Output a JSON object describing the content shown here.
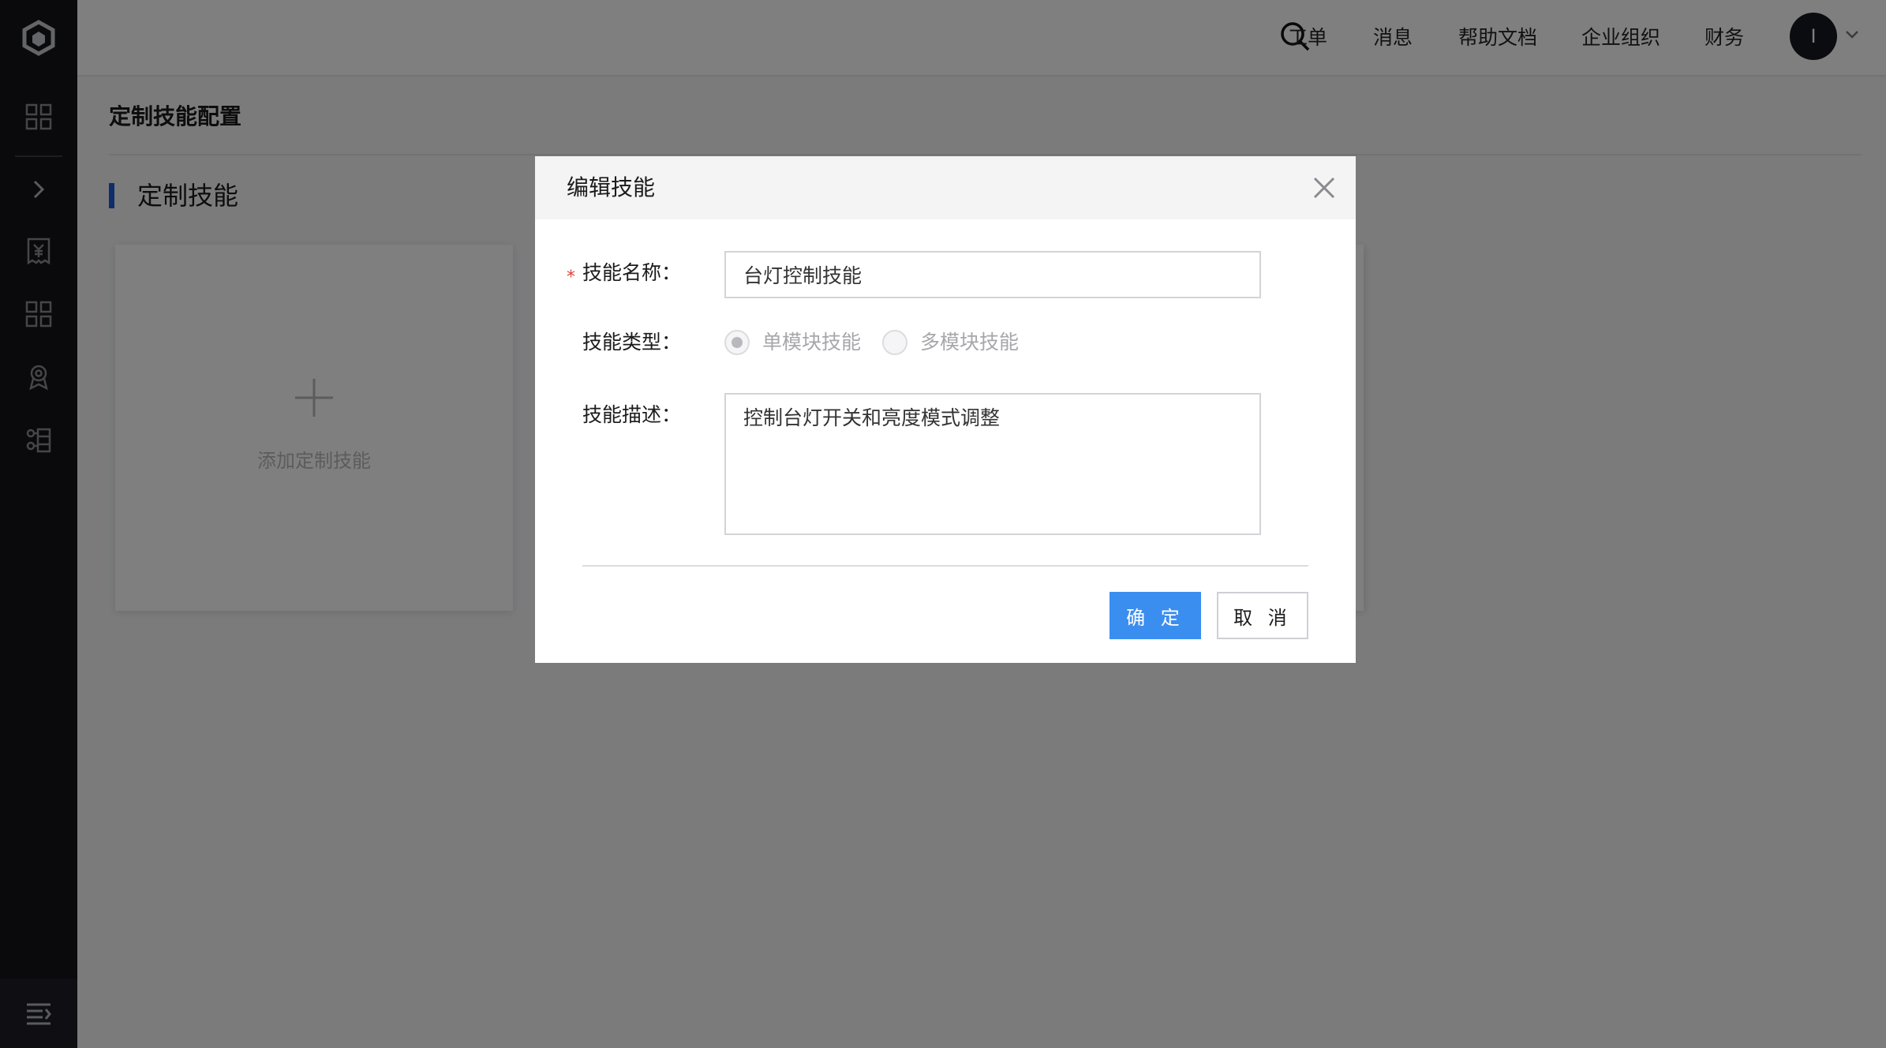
{
  "colors": {
    "sidebar_bg": "#14151b",
    "accent": "#1f5bd7",
    "primary_button": "#3a8ef0",
    "required": "#e0423d"
  },
  "sidebar": {
    "items": [
      {
        "name": "logo-icon"
      },
      {
        "name": "dashboard-grid-icon"
      },
      {
        "name": "expand-chevron-icon"
      },
      {
        "name": "billing-icon"
      },
      {
        "name": "apps-grid-icon"
      },
      {
        "name": "badge-icon"
      },
      {
        "name": "org-structure-icon"
      }
    ],
    "bottom": {
      "name": "menu-collapse-icon"
    }
  },
  "header": {
    "search_icon": "search-icon",
    "nav": [
      "工单",
      "消息",
      "帮助文档",
      "企业组织",
      "财务"
    ],
    "avatar_initial": "I"
  },
  "main": {
    "page_title": "定制技能配置",
    "section_title": "定制技能",
    "add_card_label": "添加定制技能"
  },
  "modal": {
    "title": "编辑技能",
    "fields": {
      "name": {
        "label": "技能名称：",
        "required_mark": "*",
        "value": "台灯控制技能"
      },
      "type": {
        "label": "技能类型：",
        "options": [
          {
            "label": "单模块技能",
            "checked": true
          },
          {
            "label": "多模块技能",
            "checked": false
          }
        ]
      },
      "description": {
        "label": "技能描述：",
        "value": "控制台灯开关和亮度模式调整"
      }
    },
    "confirm_label": "确 定",
    "cancel_label": "取 消"
  }
}
